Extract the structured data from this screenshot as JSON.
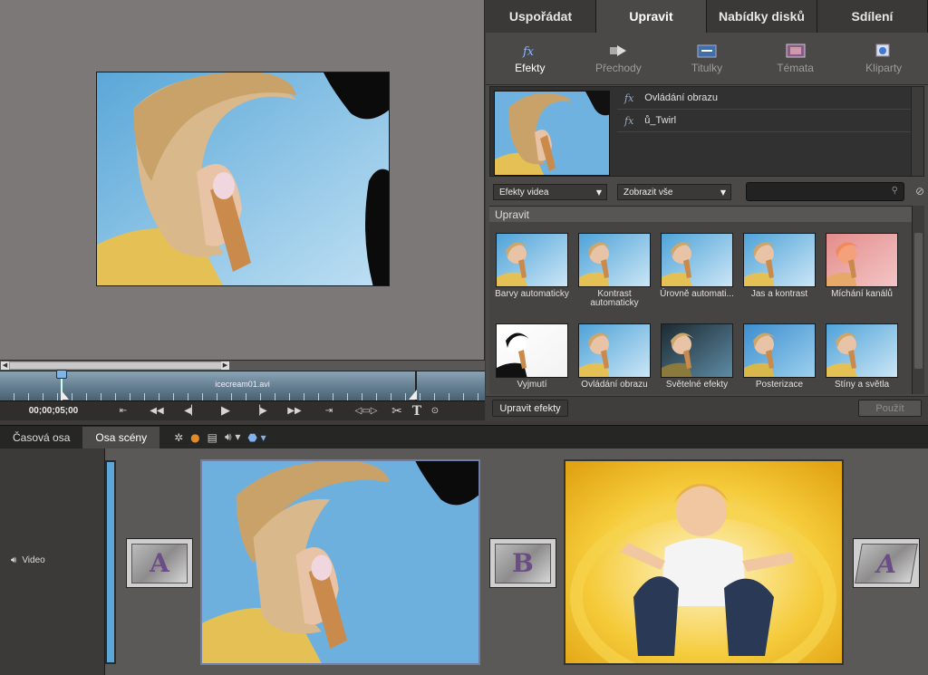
{
  "monitor": {
    "clip_name": "icecream01.avi",
    "timecode": "00;00;05;00"
  },
  "tabs": [
    {
      "label": "Uspořádat",
      "active": false
    },
    {
      "label": "Upravit",
      "active": true
    },
    {
      "label": "Nabídky disků",
      "active": false
    },
    {
      "label": "Sdílení",
      "active": false
    }
  ],
  "subtabs": [
    {
      "label": "Efekty",
      "icon": "fx-icon",
      "active": true
    },
    {
      "label": "Přechody",
      "icon": "transition-arrow-icon",
      "active": false
    },
    {
      "label": "Titulky",
      "icon": "title-icon",
      "active": false
    },
    {
      "label": "Témata",
      "icon": "theme-film-icon",
      "active": false
    },
    {
      "label": "Kliparty",
      "icon": "clipart-icon",
      "active": false
    }
  ],
  "applied_effects": [
    {
      "label": "Ovládání obrazu"
    },
    {
      "label": "ů_Twirl"
    }
  ],
  "filters": {
    "effect_type": "Efekty videa",
    "show": "Zobrazit vše",
    "search_placeholder": ""
  },
  "gallery": {
    "header": "Upravit",
    "items": [
      {
        "label": "Barvy automaticky",
        "tint": "normal"
      },
      {
        "label": "Kontrast automaticky",
        "tint": "normal"
      },
      {
        "label": "Úrovně automati...",
        "tint": "normal"
      },
      {
        "label": "Jas a kontrast",
        "tint": "normal"
      },
      {
        "label": "Míchání kanálů",
        "tint": "red"
      },
      {
        "label": "Vyjmutí",
        "tint": "bw"
      },
      {
        "label": "Ovládání obrazu",
        "tint": "normal"
      },
      {
        "label": "Světelné efekty",
        "tint": "dark"
      },
      {
        "label": "Posterizace",
        "tint": "poster"
      },
      {
        "label": "Stíny a světla",
        "tint": "normal"
      }
    ]
  },
  "bottom": {
    "edit_effects": "Upravit efekty",
    "apply": "Použít"
  },
  "lower": {
    "tabs": [
      {
        "label": "Časová osa",
        "active": false
      },
      {
        "label": "Osa scény",
        "active": true
      }
    ],
    "video_label": "Video",
    "transitions": [
      "A",
      "B",
      "A"
    ]
  }
}
